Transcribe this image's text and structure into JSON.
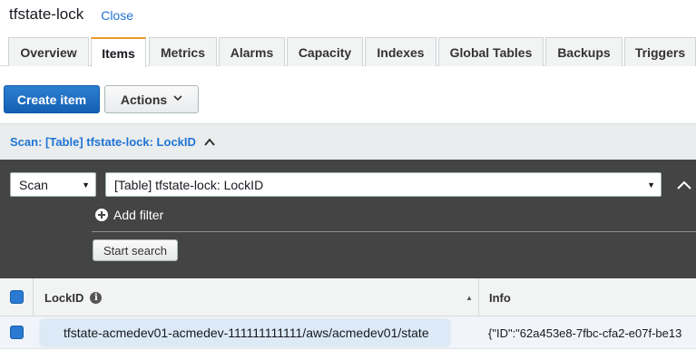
{
  "header": {
    "title": "tfstate-lock",
    "close_label": "Close"
  },
  "tabs": [
    {
      "label": "Overview",
      "active": false
    },
    {
      "label": "Items",
      "active": true
    },
    {
      "label": "Metrics",
      "active": false
    },
    {
      "label": "Alarms",
      "active": false
    },
    {
      "label": "Capacity",
      "active": false
    },
    {
      "label": "Indexes",
      "active": false
    },
    {
      "label": "Global Tables",
      "active": false
    },
    {
      "label": "Backups",
      "active": false
    },
    {
      "label": "Triggers",
      "active": false
    }
  ],
  "toolbar": {
    "create_label": "Create item",
    "actions_label": "Actions"
  },
  "scan": {
    "header_title": "Scan: [Table] tfstate-lock: LockID",
    "mode_value": "Scan",
    "target_value": "[Table] tfstate-lock: LockID",
    "add_filter_label": "Add filter",
    "start_search_label": "Start search"
  },
  "table": {
    "columns": [
      "LockID",
      "Info"
    ],
    "rows": [
      {
        "lockid": "tfstate-acmedev01-acmedev-111111111111/aws/acmedev01/state",
        "info": "{\"ID\":\"62a453e8-7fbc-cfa2-e07f-be13"
      }
    ]
  },
  "colors": {
    "accent": "#2074d5",
    "primary_button": "#1166bb",
    "active_tab_border": "#e99a2c",
    "panel_dark": "#444444"
  },
  "icons": [
    "chevron-down-icon",
    "chevron-up-icon",
    "plus-circle-icon",
    "info-icon",
    "sort-asc-icon",
    "select-caret-icon"
  ]
}
